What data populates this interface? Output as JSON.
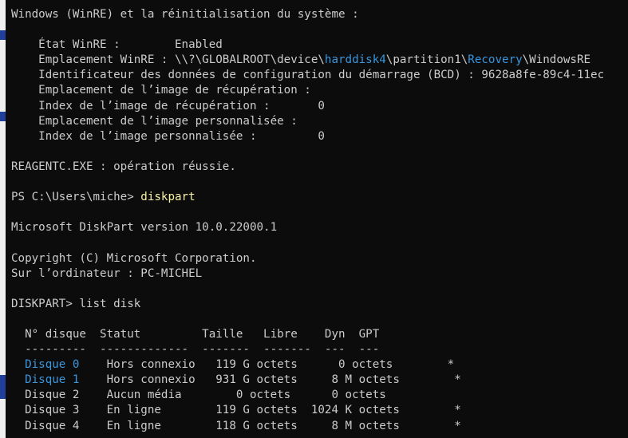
{
  "colors": {
    "background": "#0c0c0c",
    "text": "#cccccc",
    "highlight": "#3a96dd",
    "command": "#f9f1a5"
  },
  "lines": [
    {
      "segments": [
        {
          "text": "Windows (WinRE) et la réinitialisation du système :"
        }
      ]
    },
    {
      "segments": []
    },
    {
      "segments": [
        {
          "text": "    État WinRE :        Enabled"
        }
      ]
    },
    {
      "segments": [
        {
          "text": "    Emplacement WinRE : \\\\?\\GLOBALROOT\\device\\"
        },
        {
          "text": "harddisk4",
          "hl": true
        },
        {
          "text": "\\partition1\\"
        },
        {
          "text": "Recovery",
          "hl": true
        },
        {
          "text": "\\WindowsRE"
        }
      ]
    },
    {
      "segments": [
        {
          "text": "    Identificateur des données de configuration du démarrage (BCD) : 9628a8fe-89c4-11ec"
        }
      ]
    },
    {
      "segments": [
        {
          "text": "    Emplacement de l’image de récupération :"
        }
      ]
    },
    {
      "segments": [
        {
          "text": "    Index de l’image de récupération :       0"
        }
      ]
    },
    {
      "segments": [
        {
          "text": "    Emplacement de l’image personnalisée :"
        }
      ]
    },
    {
      "segments": [
        {
          "text": "    Index de l’image personnalisée :         0"
        }
      ]
    },
    {
      "segments": []
    },
    {
      "segments": [
        {
          "text": "REAGENTC.EXE : opération réussie."
        }
      ]
    },
    {
      "segments": []
    },
    {
      "segments": [
        {
          "text": "PS C:\\Users\\miche> "
        },
        {
          "text": "diskpart",
          "cmd": true
        }
      ]
    },
    {
      "segments": []
    },
    {
      "segments": [
        {
          "text": "Microsoft DiskPart version 10.0.22000.1"
        }
      ]
    },
    {
      "segments": []
    },
    {
      "segments": [
        {
          "text": "Copyright (C) Microsoft Corporation."
        }
      ]
    },
    {
      "segments": [
        {
          "text": "Sur l’ordinateur : PC-MICHEL"
        }
      ]
    },
    {
      "segments": []
    },
    {
      "segments": [
        {
          "text": "DISKPART> list disk"
        }
      ]
    },
    {
      "segments": []
    },
    {
      "segments": [
        {
          "text": "  N° disque  Statut         Taille   Libre    Dyn  GPT"
        }
      ]
    },
    {
      "segments": [
        {
          "text": "  ---------  -------------  -------  -------  ---  ---"
        }
      ]
    },
    {
      "segments": [
        {
          "text": "  "
        },
        {
          "text": "Disque 0",
          "hl": true
        },
        {
          "text": "    Hors connexio   119 G octets      0 octets        *"
        }
      ]
    },
    {
      "segments": [
        {
          "text": "  "
        },
        {
          "text": "Disque 1",
          "hl": true
        },
        {
          "text": "    Hors connexio   931 G octets     8 M octets        *"
        }
      ]
    },
    {
      "segments": [
        {
          "text": "  Disque 2    Aucun média        0 octets      0 octets"
        }
      ]
    },
    {
      "segments": [
        {
          "text": "  Disque 3    En ligne        119 G octets  1024 K octets        *"
        }
      ]
    },
    {
      "segments": [
        {
          "text": "  Disque 4    En ligne        118 G octets     8 M octets        *"
        }
      ]
    }
  ]
}
